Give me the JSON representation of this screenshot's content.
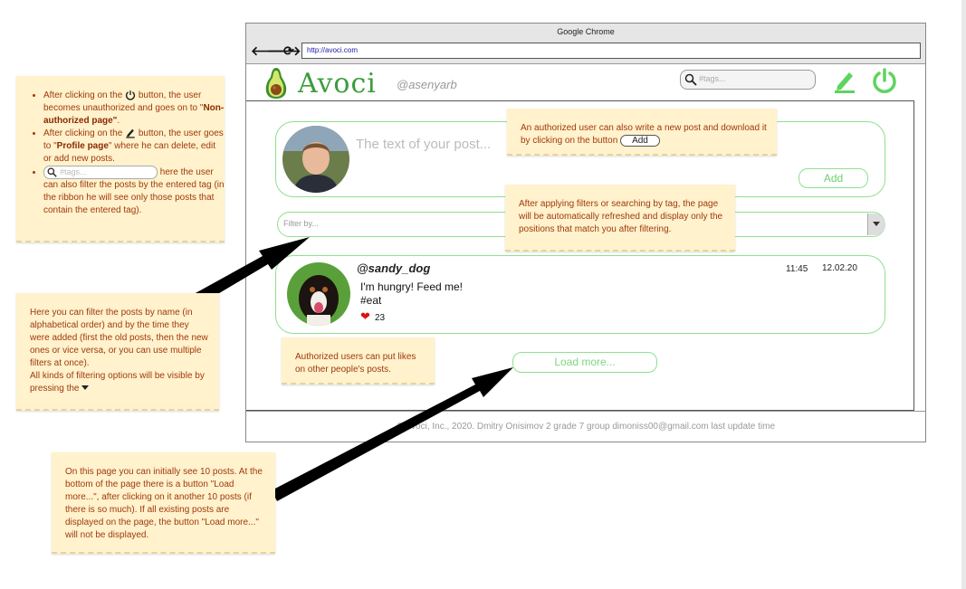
{
  "browser": {
    "window_title": "Google Chrome",
    "url": "http://avoci.com",
    "back": "🡐",
    "forward": "🡒",
    "reload": "⟳"
  },
  "header": {
    "brand": "Avoci",
    "username": "@asenyarb",
    "search_placeholder": "#tags...",
    "icons": [
      "avocado-logo",
      "search-icon",
      "edit-icon",
      "power-icon"
    ]
  },
  "new_post": {
    "placeholder": "The text of your post...",
    "add_label": "Add"
  },
  "filter": {
    "placeholder": "Filter by..."
  },
  "post": {
    "user": "@sandy_dog",
    "time": "11:45",
    "date": "12.02.20",
    "text": "I'm hungry! Feed me!",
    "tag": "#eat",
    "likes": "23"
  },
  "load_more_label": "Load more...",
  "footer": "© Avoci, Inc., 2020.   Dmitry Onisimov  2 grade 7 group   dimoniss00@gmail.com   last update time",
  "notes": {
    "left_top": {
      "item1_a": "After clicking on the",
      "item1_b": "button, the user becomes unauthorized and goes on to \"",
      "item1_bold": "Non-authorized page\"",
      "item1_c": ".",
      "item2_a": "After clicking on the",
      "item2_b": "button, the user goes to \"",
      "item2_bold": "Profile page",
      "item2_c": "\" where he can delete, edit or add new posts.",
      "item3_ph": "#tags...",
      "item3_b": "here the user can also filter the posts by the entered tag (in the ribbon he will see only those posts that contain the entered tag)."
    },
    "left_mid": {
      "text": "Here you can filter the posts by name (in alphabetical order) and by the time they were added (first the old posts, then the new ones or vice versa, or you can use multiple filters at once).",
      "text2": "All kinds of filtering options will be visible by pressing the"
    },
    "bottom": {
      "text": "On this page you can initially see 10 posts. At the bottom of the page there is a button \"Load more...\", after clicking on it another 10 posts (if there is so much). If all existing posts are displayed on the page, the button \"Load more...\" will not be displayed."
    },
    "new_post": {
      "text": "An authorized user can also write a new post and download it by clicking on the button",
      "button": "Add"
    },
    "filter": {
      "text": "After applying filters or searching by tag, the page will be automatically refreshed and display only the positions that match you after filtering."
    },
    "likes": {
      "text": "Authorized users can put likes on other people's posts."
    }
  },
  "colors": {
    "accent_green": "#8fe08f",
    "brand_green": "#3c9c3c",
    "note_bg": "#fff2cc",
    "note_text": "#a0390e"
  }
}
